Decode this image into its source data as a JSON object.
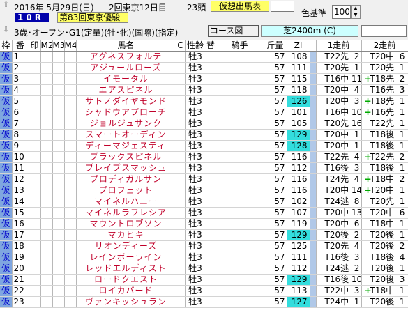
{
  "header": {
    "date": "2016年 5月29日(日)",
    "meet": "2回東京12日目",
    "runners": "23頭",
    "sheet_button": "仮想出馬表",
    "race_no": "10R",
    "race_name": "第83回東京優駿",
    "conditions": "3歳･オープン･G1(定量)(牡･牝)(国際)(指定)",
    "color_label": "色基準",
    "color_value": "100",
    "course_button": "コース図",
    "distance": "芝2400m (C)"
  },
  "columns": [
    "枠",
    "番",
    "印",
    "M2",
    "M3",
    "M4",
    "馬名",
    "C",
    "性齢",
    "替",
    "騎手",
    "斤量",
    "ZI",
    "1走前",
    "2走前"
  ],
  "rows": [
    {
      "waku": "仮",
      "no": "1",
      "name": "アグネスフォルテ",
      "sexage": "牡3",
      "weight": "57",
      "zi": "108",
      "zihi": false,
      "r1": "T22先  2",
      "r1g": false,
      "r2": "T20中  6",
      "r2g": false
    },
    {
      "waku": "仮",
      "no": "2",
      "name": "アジュールローズ",
      "sexage": "牡3",
      "weight": "57",
      "zi": "111",
      "zihi": false,
      "r1": "T20先  1",
      "r1g": false,
      "r2": "T20先  1",
      "r2g": false
    },
    {
      "waku": "仮",
      "no": "3",
      "name": "イモータル",
      "sexage": "牡3",
      "weight": "57",
      "zi": "115",
      "zihi": false,
      "r1": "T16中 11",
      "r1g": false,
      "r2": "T18先  2",
      "r2g": true
    },
    {
      "waku": "仮",
      "no": "4",
      "name": "エアスピネル",
      "sexage": "牡3",
      "weight": "57",
      "zi": "118",
      "zihi": false,
      "r1": "T20中  4",
      "r1g": false,
      "r2": "T16先  3",
      "r2g": false
    },
    {
      "waku": "仮",
      "no": "5",
      "name": "サトノダイヤモンド",
      "sexage": "牡3",
      "weight": "57",
      "zi": "126",
      "zihi": true,
      "r1": "T20中  3",
      "r1g": false,
      "r2": "T18先  1",
      "r2g": true
    },
    {
      "waku": "仮",
      "no": "6",
      "name": "シャドウアプローチ",
      "sexage": "牡3",
      "weight": "57",
      "zi": "101",
      "zihi": false,
      "r1": "T16中 10",
      "r1g": false,
      "r2": "T16先  1",
      "r2g": true
    },
    {
      "waku": "仮",
      "no": "7",
      "name": "ジョルジュサンク",
      "sexage": "牡3",
      "weight": "57",
      "zi": "105",
      "zihi": false,
      "r1": "T20先 16",
      "r1g": false,
      "r2": "T22先  1",
      "r2g": false
    },
    {
      "waku": "仮",
      "no": "8",
      "name": "スマートオーディン",
      "sexage": "牡3",
      "weight": "57",
      "zi": "129",
      "zihi": true,
      "r1": "T20中  1",
      "r1g": false,
      "r2": "T18後  1",
      "r2g": false
    },
    {
      "waku": "仮",
      "no": "9",
      "name": "ディーマジェスティ",
      "sexage": "牡3",
      "weight": "57",
      "zi": "128",
      "zihi": true,
      "r1": "T20中  1",
      "r1g": false,
      "r2": "T18後  1",
      "r2g": false
    },
    {
      "waku": "仮",
      "no": "10",
      "name": "ブラックスピネル",
      "sexage": "牡3",
      "weight": "57",
      "zi": "116",
      "zihi": false,
      "r1": "T22先  4",
      "r1g": false,
      "r2": "T22先  2",
      "r2g": true
    },
    {
      "waku": "仮",
      "no": "11",
      "name": "ブレイブスマッシュ",
      "sexage": "牡3",
      "weight": "57",
      "zi": "112",
      "zihi": false,
      "r1": "T16後  3",
      "r1g": false,
      "r2": "T18後  1",
      "r2g": false
    },
    {
      "waku": "仮",
      "no": "12",
      "name": "プロディガルサン",
      "sexage": "牡3",
      "weight": "57",
      "zi": "116",
      "zihi": false,
      "r1": "T24先  4",
      "r1g": false,
      "r2": "T18中  2",
      "r2g": true
    },
    {
      "waku": "仮",
      "no": "13",
      "name": "プロフェット",
      "sexage": "牡3",
      "weight": "57",
      "zi": "116",
      "zihi": false,
      "r1": "T20中 14",
      "r1g": false,
      "r2": "T20中  1",
      "r2g": true
    },
    {
      "waku": "仮",
      "no": "14",
      "name": "マイネルハニー",
      "sexage": "牡3",
      "weight": "57",
      "zi": "102",
      "zihi": false,
      "r1": "T24逃  8",
      "r1g": false,
      "r2": "T20先  1",
      "r2g": false
    },
    {
      "waku": "仮",
      "no": "15",
      "name": "マイネルラフレシア",
      "sexage": "牡3",
      "weight": "57",
      "zi": "107",
      "zihi": false,
      "r1": "T20中 13",
      "r1g": false,
      "r2": "T20中  6",
      "r2g": false
    },
    {
      "waku": "仮",
      "no": "16",
      "name": "マウントロブソン",
      "sexage": "牡3",
      "weight": "57",
      "zi": "119",
      "zihi": false,
      "r1": "T20中  6",
      "r1g": false,
      "r2": "T18中  1",
      "r2g": false
    },
    {
      "waku": "仮",
      "no": "17",
      "name": "マカヒキ",
      "sexage": "牡3",
      "weight": "57",
      "zi": "129",
      "zihi": true,
      "r1": "T20後  2",
      "r1g": false,
      "r2": "T20後  1",
      "r2g": false
    },
    {
      "waku": "仮",
      "no": "18",
      "name": "リオンディーズ",
      "sexage": "牡3",
      "weight": "57",
      "zi": "125",
      "zihi": false,
      "r1": "T20先  4",
      "r1g": false,
      "r2": "T20後  2",
      "r2g": false
    },
    {
      "waku": "仮",
      "no": "19",
      "name": "レインボーライン",
      "sexage": "牡3",
      "weight": "57",
      "zi": "111",
      "zihi": false,
      "r1": "T16後  3",
      "r1g": false,
      "r2": "T18後  4",
      "r2g": false
    },
    {
      "waku": "仮",
      "no": "20",
      "name": "レッドエルディスト",
      "sexage": "牡3",
      "weight": "57",
      "zi": "112",
      "zihi": false,
      "r1": "T24逃  2",
      "r1g": false,
      "r2": "T20後  1",
      "r2g": false
    },
    {
      "waku": "仮",
      "no": "21",
      "name": "ロードクエスト",
      "sexage": "牡3",
      "weight": "57",
      "zi": "129",
      "zihi": true,
      "r1": "T16後 10",
      "r1g": false,
      "r2": "T20後  3",
      "r2g": false
    },
    {
      "waku": "仮",
      "no": "22",
      "name": "ロイカバード",
      "sexage": "牡3",
      "weight": "57",
      "zi": "113",
      "zihi": false,
      "r1": "T22中  3",
      "r1g": false,
      "r2": "T18中  1",
      "r2g": true
    },
    {
      "waku": "仮",
      "no": "23",
      "name": "ヴァンキッシュラン",
      "sexage": "牡3",
      "weight": "57",
      "zi": "127",
      "zihi": true,
      "r1": "T24中  1",
      "r1g": false,
      "r2": "T20後  1",
      "r2g": false
    }
  ],
  "colors": {
    "waku_bg": "#7fa6e0",
    "zi_highlight": "#33dddd",
    "name_text": "#c0002a",
    "race_box": "#0000aa",
    "yellow": "#ffff66",
    "green_mark": "#00aa00"
  }
}
